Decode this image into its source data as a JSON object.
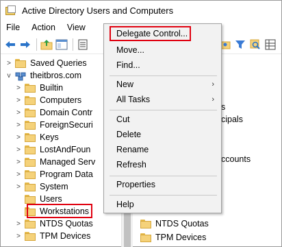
{
  "window": {
    "title": "Active Directory Users and Computers"
  },
  "menu": [
    "File",
    "Action",
    "View"
  ],
  "toolbar": {
    "icons": [
      "back-arrow-icon",
      "forward-arrow-icon",
      "up-folder-icon",
      "console-tree-icon",
      "properties-icon",
      "new-group-icon",
      "filter-icon",
      "find-icon",
      "grid-icon"
    ]
  },
  "tree": {
    "items": [
      {
        "label": "Saved Queries",
        "expand": "collapsed"
      },
      {
        "label": "theitbros.com",
        "expand": "expanded"
      },
      {
        "label": "Builtin",
        "expand": "collapsed"
      },
      {
        "label": "Computers",
        "expand": "collapsed"
      },
      {
        "label": "Domain Contr",
        "expand": "collapsed"
      },
      {
        "label": "ForeignSecuri",
        "expand": "collapsed"
      },
      {
        "label": "Keys",
        "expand": "collapsed"
      },
      {
        "label": "LostAndFoun",
        "expand": "collapsed"
      },
      {
        "label": "Managed Serv",
        "expand": "collapsed"
      },
      {
        "label": "Program Data",
        "expand": "collapsed"
      },
      {
        "label": "System",
        "expand": "collapsed"
      },
      {
        "label": "Users",
        "expand": "none"
      },
      {
        "label": "Workstations",
        "expand": "none",
        "selected": true
      },
      {
        "label": "NTDS Quotas",
        "expand": "collapsed"
      },
      {
        "label": "TPM Devices",
        "expand": "collapsed"
      }
    ]
  },
  "right_pane": {
    "fragments": [
      "s",
      "cipals",
      "ccounts"
    ],
    "items": [
      "NTDS Quotas",
      "TPM Devices"
    ]
  },
  "context_menu": {
    "items": [
      {
        "label": "Delegate Control...",
        "highlighted": true
      },
      {
        "label": "Move..."
      },
      {
        "label": "Find..."
      },
      {
        "label": "New",
        "submenu": true
      },
      {
        "label": "All Tasks",
        "submenu": true
      },
      {
        "label": "Cut"
      },
      {
        "label": "Delete"
      },
      {
        "label": "Rename"
      },
      {
        "label": "Refresh"
      },
      {
        "label": "Properties"
      },
      {
        "label": "Help"
      }
    ],
    "submenu_glyph": "›"
  },
  "colors": {
    "highlight_border": "#e0000f",
    "folder": "#f5d27a",
    "menu_bg": "#f2f2f2"
  }
}
